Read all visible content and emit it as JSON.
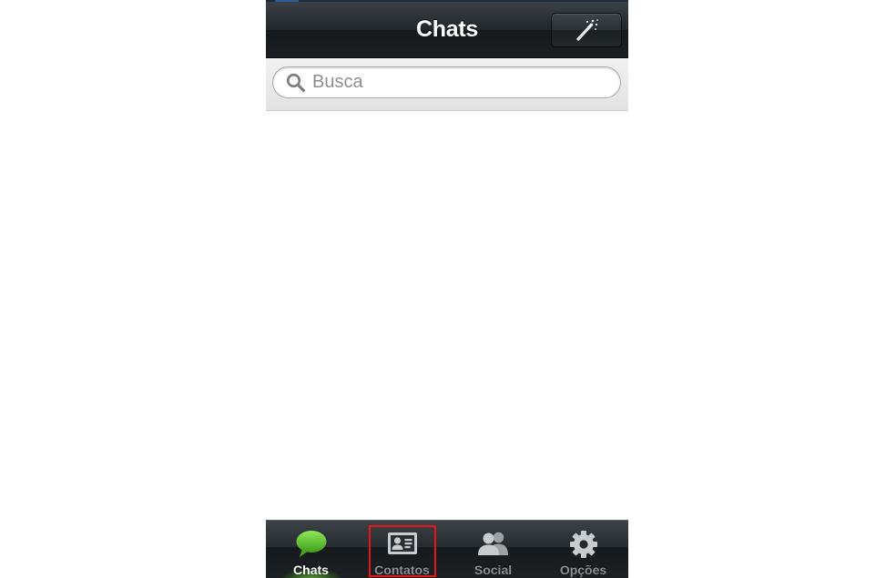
{
  "header": {
    "title": "Chats",
    "action_icon": "magic-wand-icon"
  },
  "search": {
    "placeholder": "Busca",
    "value": "",
    "icon": "search-icon"
  },
  "tabbar": {
    "tabs": [
      {
        "label": "Chats",
        "icon": "chat-bubble-icon",
        "active": true
      },
      {
        "label": "Contatos",
        "icon": "contact-card-icon",
        "active": false,
        "highlighted": true
      },
      {
        "label": "Social",
        "icon": "people-icon",
        "active": false
      },
      {
        "label": "Opções",
        "icon": "gear-icon",
        "active": false
      }
    ]
  },
  "colors": {
    "active_tab_icon": "#5cc22e",
    "inactive_tab_icon": "#c9ccce",
    "highlight_border": "#e8161b",
    "navbar_dark": "#1b1f22"
  }
}
